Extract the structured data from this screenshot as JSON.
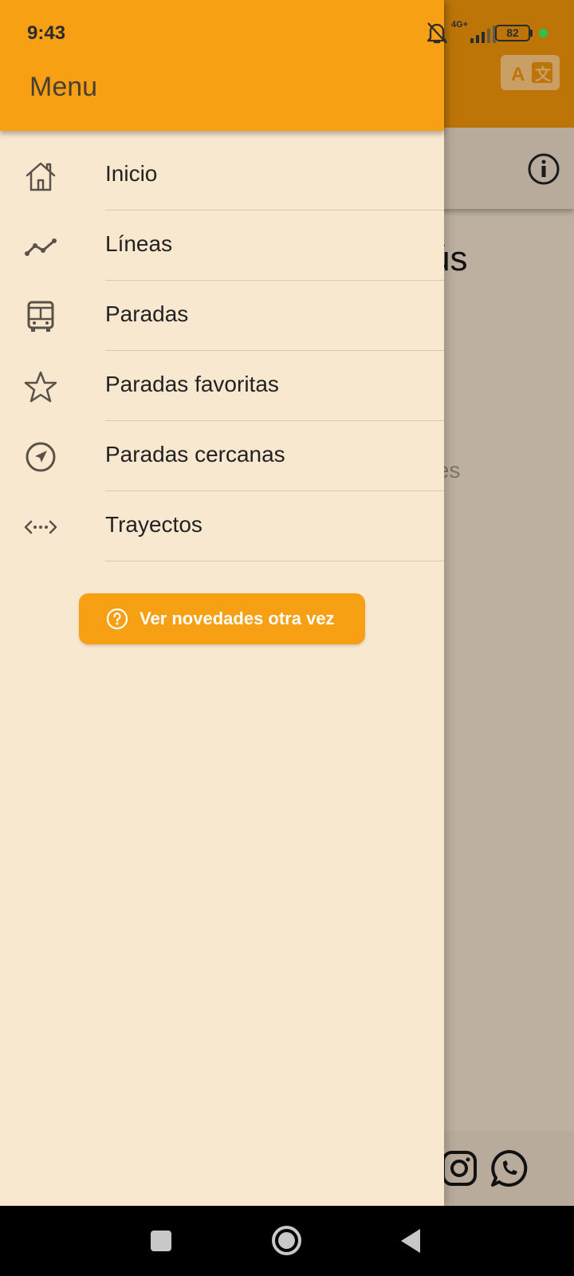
{
  "status_bar": {
    "time": "9:43",
    "network": "4G+",
    "battery": "82"
  },
  "background": {
    "title_fragment": "ús",
    "hint_fragment": "tes"
  },
  "drawer": {
    "title": "Menu",
    "items": [
      {
        "label": "Inicio",
        "icon": "home-icon"
      },
      {
        "label": "Líneas",
        "icon": "route-line-icon"
      },
      {
        "label": "Paradas",
        "icon": "bus-icon"
      },
      {
        "label": "Paradas favoritas",
        "icon": "star-icon"
      },
      {
        "label": "Paradas cercanas",
        "icon": "navigation-icon"
      },
      {
        "label": "Trayectos",
        "icon": "trip-arrows-icon"
      }
    ],
    "news_button": {
      "label": "Ver novedades otra vez",
      "icon": "help-circle-icon"
    }
  },
  "colors": {
    "accent": "#F8A014",
    "drawer_bg": "#F8E8D0",
    "scrim_appbar": "#BD7508"
  }
}
